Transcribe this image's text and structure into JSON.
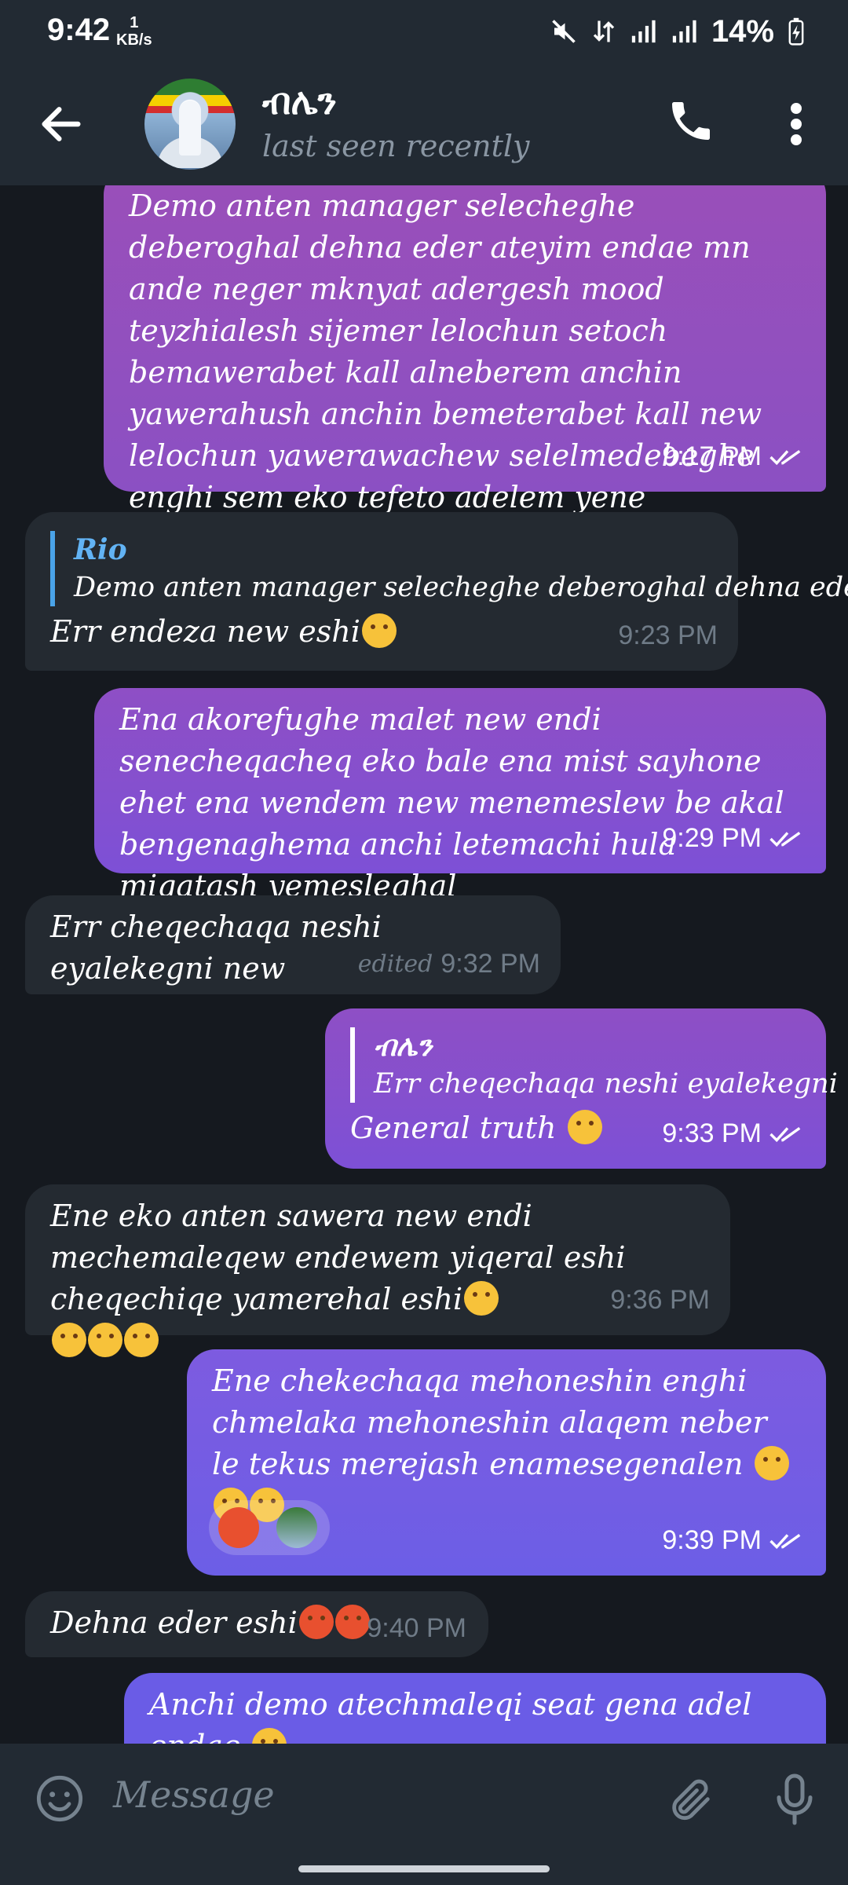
{
  "status_bar": {
    "time": "9:42",
    "net_speed_value": "1",
    "net_speed_unit": "KB/s",
    "battery": "14%"
  },
  "header": {
    "title": "ብሌን",
    "subtitle": "last seen recently"
  },
  "messages": [
    {
      "text": "Demo anten manager selecheghe deberoghal dehna eder ateyim endae mn ande neger mknyat adergesh mood teyzhialesh sijemer lelochun setoch bemawerabet kall alneberem anchin yawerahush anchin bemeterabet kall new lelochun yawerawachew selelmedebeghe enghi sem eko tefeto adelem yene chekechaka",
      "time": "9:17 PM"
    },
    {
      "reply_name": "Rio",
      "reply_text": "Demo anten manager selecheghe deberoghal dehna ede...",
      "text": "Err endeza new eshi",
      "time": "9:23 PM"
    },
    {
      "text": "Ena akorefughe malet new endi senecheqacheq eko bale ena mist sayhone ehet ena wendem new menemeslew be akal bengenaghema anchi letemachi hula miqatash yemesleghal",
      "time": "9:29 PM"
    },
    {
      "text": "Err cheqechaqa neshi eyalekegni  new",
      "edited": "edited",
      "time": "9:32 PM"
    },
    {
      "reply_name": "ብሌን",
      "reply_text": "Err cheqechaqa neshi eyalekegni  new",
      "text": "General truth",
      "time": "9:33 PM"
    },
    {
      "text": "Ene eko anten sawera new endi mechemaleqew endewem yiqeral eshi cheqechiqe yamerehal eshi",
      "time": "9:36 PM"
    },
    {
      "text": "Ene chekechaqa mehoneshin enghi chmelaka mehoneshin alaqem neber le tekus merejash enamesegenalen",
      "time": "9:39 PM"
    },
    {
      "text": "Dehna eder eshi",
      "time": "9:40 PM"
    },
    {
      "text": "Anchi demo atechmaleqi seat gena adel endae"
    }
  ],
  "composer": {
    "placeholder": "Message"
  },
  "colors": {
    "outgoing": "#8a50cc",
    "incoming": "#242a31",
    "background": "#15191f",
    "header": "#222a33",
    "reply_accent": "#4aa3e8"
  }
}
